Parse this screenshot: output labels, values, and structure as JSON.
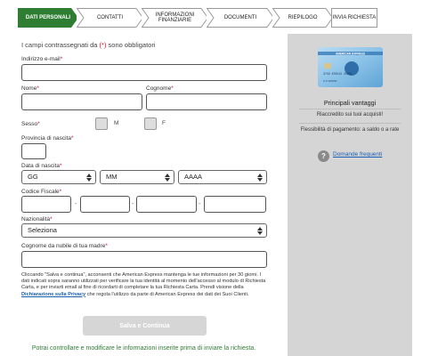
{
  "steps": [
    {
      "label": "DATI PERSONALI",
      "active": true
    },
    {
      "label": "CONTATTI",
      "active": false
    },
    {
      "label": "INFORMAZIONI FINANZIARIE",
      "active": false
    },
    {
      "label": "DOCUMENTI",
      "active": false
    },
    {
      "label": "RIEPILOGO",
      "active": false
    },
    {
      "label": "INVIA RICHIESTA",
      "active": false
    }
  ],
  "colors": {
    "accent": "#2e7d32",
    "required": "#c8102e",
    "link": "#1a5fb4",
    "panel": "#d5d5d5"
  },
  "form": {
    "required_note_pre": "I campi contrassegnati da ",
    "required_note_mark": "(*)",
    "required_note_post": " sono obbligatori",
    "email_label": "Indirizzo e-mail",
    "email_star": "*",
    "nome_label": "Nome",
    "cognome_label": "Cognome",
    "sesso_label": "Sesso",
    "sesso_m": "M",
    "sesso_f": "F",
    "provincia_label": "Provincia di nascita",
    "data_label": "Data di nascita",
    "day_value": "GG",
    "month_value": "MM",
    "year_value": "AAAA",
    "cf_label": "Codice Fiscale",
    "cf_sep": "-",
    "nazionalita_label": "Nazionalità",
    "nazionalita_value": "Seleziona",
    "madre_label": "Cognome da nubile di tua madre",
    "star": "*"
  },
  "consent": {
    "text1": "Cliccando \"Salva e continua\", acconsenti che American Express mantenga le tue informazioni per 30 giorni. I dati indicati sopra saranno utilizzati per verificare la tua identità al momento dell'accesso al modulo di Richiesta Carta, e per inviarti email al fine di ricordarti di completare la tua Richiesta Carta. Prendi visione della ",
    "link": "Dichiarazione sulla Privacy",
    "text2": " che regola l'utilizzo da parte di American Express dei dati dei Suoi Clienti."
  },
  "submit_label": "Salva e Continua",
  "footer_note": "Potrai controllare e modificare le informazioni inserite prima di inviare la richiesta.",
  "panel": {
    "title": "Principali vantaggi",
    "item1": "Riaccredito sui tuoi acquisti!",
    "item2": "Flessibilità di pagamento: a saldo o a rate",
    "faq_icon": "?",
    "faq_link": "Domande frequenti",
    "card_brand": "AMERICAN EXPRESS",
    "card_number": "3759 876543 21001",
    "card_name": "C F FROST",
    "icon": "question-icon"
  }
}
